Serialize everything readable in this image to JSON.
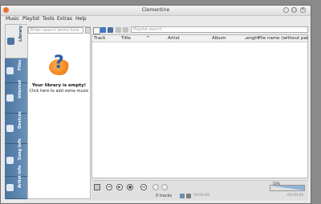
{
  "window": {
    "title": "Clementine",
    "min_symbol": "–",
    "max_symbol": "□",
    "close_symbol": "×"
  },
  "menu": [
    "Music",
    "Playlist",
    "Tools",
    "Extras",
    "Help"
  ],
  "tabs": [
    {
      "label": "Library",
      "icon": "library-icon"
    },
    {
      "label": "Files",
      "icon": "folder-icon"
    },
    {
      "label": "Internet",
      "icon": "internet-icon"
    },
    {
      "label": "Devices",
      "icon": "device-icon"
    },
    {
      "label": "Song info",
      "icon": "song-info-icon"
    },
    {
      "label": "Artist info",
      "icon": "artist-info-icon"
    }
  ],
  "library": {
    "search_placeholder": "Enter search terms here",
    "empty_title": "Your library is empty!",
    "empty_subtitle": "Click here to add some music",
    "empty_icon": "?"
  },
  "playlist": {
    "search_placeholder": "Playlist search",
    "columns": [
      "Track",
      "Title",
      "^",
      "Artist",
      "Album",
      "Length",
      "File name (without path)"
    ]
  },
  "controls": {
    "prev": "⏮",
    "play": "▶",
    "stop": "■",
    "next": "⏭",
    "status": "0 tracks",
    "time_elapsed": "00:00:00",
    "time_total": "00:00:00",
    "volume_label": "50%"
  }
}
